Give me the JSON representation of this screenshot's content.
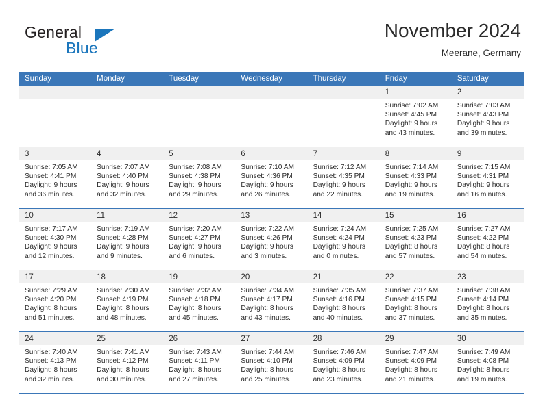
{
  "brand": {
    "word_one": "General",
    "word_two": "Blue",
    "mark": "triangle-logo"
  },
  "header": {
    "title": "November 2024",
    "location": "Meerane, Germany"
  },
  "calendar": {
    "weekdays": [
      "Sunday",
      "Monday",
      "Tuesday",
      "Wednesday",
      "Thursday",
      "Friday",
      "Saturday"
    ],
    "colors": {
      "header_blue": "#3b77b8",
      "band_gray": "#f0f0f0",
      "text": "#2b2b2b",
      "brand_blue": "#1b76bc"
    },
    "weeks": [
      [
        {
          "day": "",
          "sunrise": "",
          "sunset": "",
          "daylight_line1": "",
          "daylight_line2": ""
        },
        {
          "day": "",
          "sunrise": "",
          "sunset": "",
          "daylight_line1": "",
          "daylight_line2": ""
        },
        {
          "day": "",
          "sunrise": "",
          "sunset": "",
          "daylight_line1": "",
          "daylight_line2": ""
        },
        {
          "day": "",
          "sunrise": "",
          "sunset": "",
          "daylight_line1": "",
          "daylight_line2": ""
        },
        {
          "day": "",
          "sunrise": "",
          "sunset": "",
          "daylight_line1": "",
          "daylight_line2": ""
        },
        {
          "day": "1",
          "sunrise": "Sunrise: 7:02 AM",
          "sunset": "Sunset: 4:45 PM",
          "daylight_line1": "Daylight: 9 hours",
          "daylight_line2": "and 43 minutes."
        },
        {
          "day": "2",
          "sunrise": "Sunrise: 7:03 AM",
          "sunset": "Sunset: 4:43 PM",
          "daylight_line1": "Daylight: 9 hours",
          "daylight_line2": "and 39 minutes."
        }
      ],
      [
        {
          "day": "3",
          "sunrise": "Sunrise: 7:05 AM",
          "sunset": "Sunset: 4:41 PM",
          "daylight_line1": "Daylight: 9 hours",
          "daylight_line2": "and 36 minutes."
        },
        {
          "day": "4",
          "sunrise": "Sunrise: 7:07 AM",
          "sunset": "Sunset: 4:40 PM",
          "daylight_line1": "Daylight: 9 hours",
          "daylight_line2": "and 32 minutes."
        },
        {
          "day": "5",
          "sunrise": "Sunrise: 7:08 AM",
          "sunset": "Sunset: 4:38 PM",
          "daylight_line1": "Daylight: 9 hours",
          "daylight_line2": "and 29 minutes."
        },
        {
          "day": "6",
          "sunrise": "Sunrise: 7:10 AM",
          "sunset": "Sunset: 4:36 PM",
          "daylight_line1": "Daylight: 9 hours",
          "daylight_line2": "and 26 minutes."
        },
        {
          "day": "7",
          "sunrise": "Sunrise: 7:12 AM",
          "sunset": "Sunset: 4:35 PM",
          "daylight_line1": "Daylight: 9 hours",
          "daylight_line2": "and 22 minutes."
        },
        {
          "day": "8",
          "sunrise": "Sunrise: 7:14 AM",
          "sunset": "Sunset: 4:33 PM",
          "daylight_line1": "Daylight: 9 hours",
          "daylight_line2": "and 19 minutes."
        },
        {
          "day": "9",
          "sunrise": "Sunrise: 7:15 AM",
          "sunset": "Sunset: 4:31 PM",
          "daylight_line1": "Daylight: 9 hours",
          "daylight_line2": "and 16 minutes."
        }
      ],
      [
        {
          "day": "10",
          "sunrise": "Sunrise: 7:17 AM",
          "sunset": "Sunset: 4:30 PM",
          "daylight_line1": "Daylight: 9 hours",
          "daylight_line2": "and 12 minutes."
        },
        {
          "day": "11",
          "sunrise": "Sunrise: 7:19 AM",
          "sunset": "Sunset: 4:28 PM",
          "daylight_line1": "Daylight: 9 hours",
          "daylight_line2": "and 9 minutes."
        },
        {
          "day": "12",
          "sunrise": "Sunrise: 7:20 AM",
          "sunset": "Sunset: 4:27 PM",
          "daylight_line1": "Daylight: 9 hours",
          "daylight_line2": "and 6 minutes."
        },
        {
          "day": "13",
          "sunrise": "Sunrise: 7:22 AM",
          "sunset": "Sunset: 4:26 PM",
          "daylight_line1": "Daylight: 9 hours",
          "daylight_line2": "and 3 minutes."
        },
        {
          "day": "14",
          "sunrise": "Sunrise: 7:24 AM",
          "sunset": "Sunset: 4:24 PM",
          "daylight_line1": "Daylight: 9 hours",
          "daylight_line2": "and 0 minutes."
        },
        {
          "day": "15",
          "sunrise": "Sunrise: 7:25 AM",
          "sunset": "Sunset: 4:23 PM",
          "daylight_line1": "Daylight: 8 hours",
          "daylight_line2": "and 57 minutes."
        },
        {
          "day": "16",
          "sunrise": "Sunrise: 7:27 AM",
          "sunset": "Sunset: 4:22 PM",
          "daylight_line1": "Daylight: 8 hours",
          "daylight_line2": "and 54 minutes."
        }
      ],
      [
        {
          "day": "17",
          "sunrise": "Sunrise: 7:29 AM",
          "sunset": "Sunset: 4:20 PM",
          "daylight_line1": "Daylight: 8 hours",
          "daylight_line2": "and 51 minutes."
        },
        {
          "day": "18",
          "sunrise": "Sunrise: 7:30 AM",
          "sunset": "Sunset: 4:19 PM",
          "daylight_line1": "Daylight: 8 hours",
          "daylight_line2": "and 48 minutes."
        },
        {
          "day": "19",
          "sunrise": "Sunrise: 7:32 AM",
          "sunset": "Sunset: 4:18 PM",
          "daylight_line1": "Daylight: 8 hours",
          "daylight_line2": "and 45 minutes."
        },
        {
          "day": "20",
          "sunrise": "Sunrise: 7:34 AM",
          "sunset": "Sunset: 4:17 PM",
          "daylight_line1": "Daylight: 8 hours",
          "daylight_line2": "and 43 minutes."
        },
        {
          "day": "21",
          "sunrise": "Sunrise: 7:35 AM",
          "sunset": "Sunset: 4:16 PM",
          "daylight_line1": "Daylight: 8 hours",
          "daylight_line2": "and 40 minutes."
        },
        {
          "day": "22",
          "sunrise": "Sunrise: 7:37 AM",
          "sunset": "Sunset: 4:15 PM",
          "daylight_line1": "Daylight: 8 hours",
          "daylight_line2": "and 37 minutes."
        },
        {
          "day": "23",
          "sunrise": "Sunrise: 7:38 AM",
          "sunset": "Sunset: 4:14 PM",
          "daylight_line1": "Daylight: 8 hours",
          "daylight_line2": "and 35 minutes."
        }
      ],
      [
        {
          "day": "24",
          "sunrise": "Sunrise: 7:40 AM",
          "sunset": "Sunset: 4:13 PM",
          "daylight_line1": "Daylight: 8 hours",
          "daylight_line2": "and 32 minutes."
        },
        {
          "day": "25",
          "sunrise": "Sunrise: 7:41 AM",
          "sunset": "Sunset: 4:12 PM",
          "daylight_line1": "Daylight: 8 hours",
          "daylight_line2": "and 30 minutes."
        },
        {
          "day": "26",
          "sunrise": "Sunrise: 7:43 AM",
          "sunset": "Sunset: 4:11 PM",
          "daylight_line1": "Daylight: 8 hours",
          "daylight_line2": "and 27 minutes."
        },
        {
          "day": "27",
          "sunrise": "Sunrise: 7:44 AM",
          "sunset": "Sunset: 4:10 PM",
          "daylight_line1": "Daylight: 8 hours",
          "daylight_line2": "and 25 minutes."
        },
        {
          "day": "28",
          "sunrise": "Sunrise: 7:46 AM",
          "sunset": "Sunset: 4:09 PM",
          "daylight_line1": "Daylight: 8 hours",
          "daylight_line2": "and 23 minutes."
        },
        {
          "day": "29",
          "sunrise": "Sunrise: 7:47 AM",
          "sunset": "Sunset: 4:09 PM",
          "daylight_line1": "Daylight: 8 hours",
          "daylight_line2": "and 21 minutes."
        },
        {
          "day": "30",
          "sunrise": "Sunrise: 7:49 AM",
          "sunset": "Sunset: 4:08 PM",
          "daylight_line1": "Daylight: 8 hours",
          "daylight_line2": "and 19 minutes."
        }
      ]
    ]
  }
}
